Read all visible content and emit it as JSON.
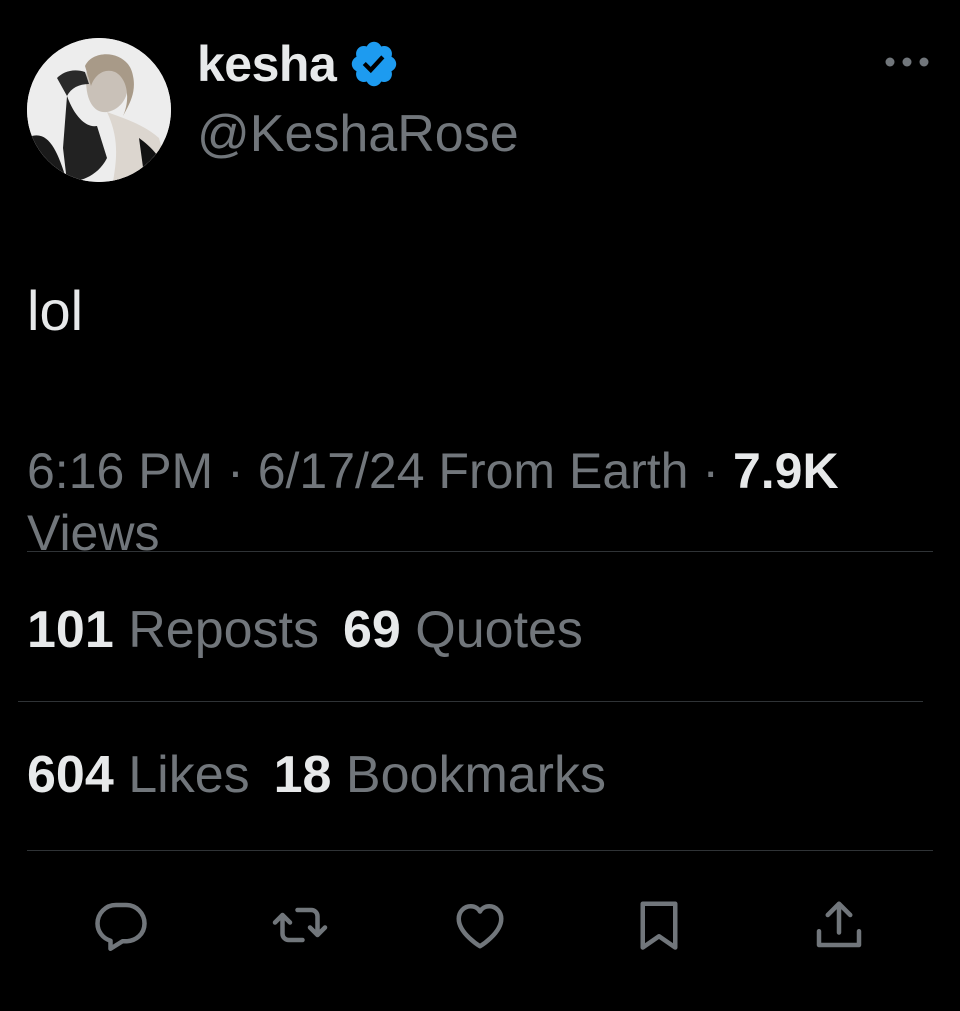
{
  "author": {
    "display_name": "kesha",
    "handle": "@KeshaRose",
    "verified_icon": "verified-badge-icon",
    "avatar": "avatar-photo"
  },
  "menu_icon": "more-options-icon",
  "tweet": {
    "text": "lol",
    "time": "6:16 PM",
    "separator": "·",
    "date": "6/17/24",
    "source": "From Earth",
    "views_count": "7.9K",
    "views_label": "Views"
  },
  "stats": {
    "reposts_count": "101",
    "reposts_label": "Reposts",
    "quotes_count": "69",
    "quotes_label": "Quotes",
    "likes_count": "604",
    "likes_label": "Likes",
    "bookmarks_count": "18",
    "bookmarks_label": "Bookmarks"
  },
  "actions": [
    {
      "icon": "reply-icon"
    },
    {
      "icon": "repost-icon"
    },
    {
      "icon": "like-icon"
    },
    {
      "icon": "bookmark-icon"
    },
    {
      "icon": "share-icon"
    }
  ],
  "colors": {
    "background": "#000000",
    "primary_text": "#e7e9ea",
    "secondary_text": "#71767b",
    "verified_blue": "#1d9bf0",
    "divider": "#2f3336"
  }
}
